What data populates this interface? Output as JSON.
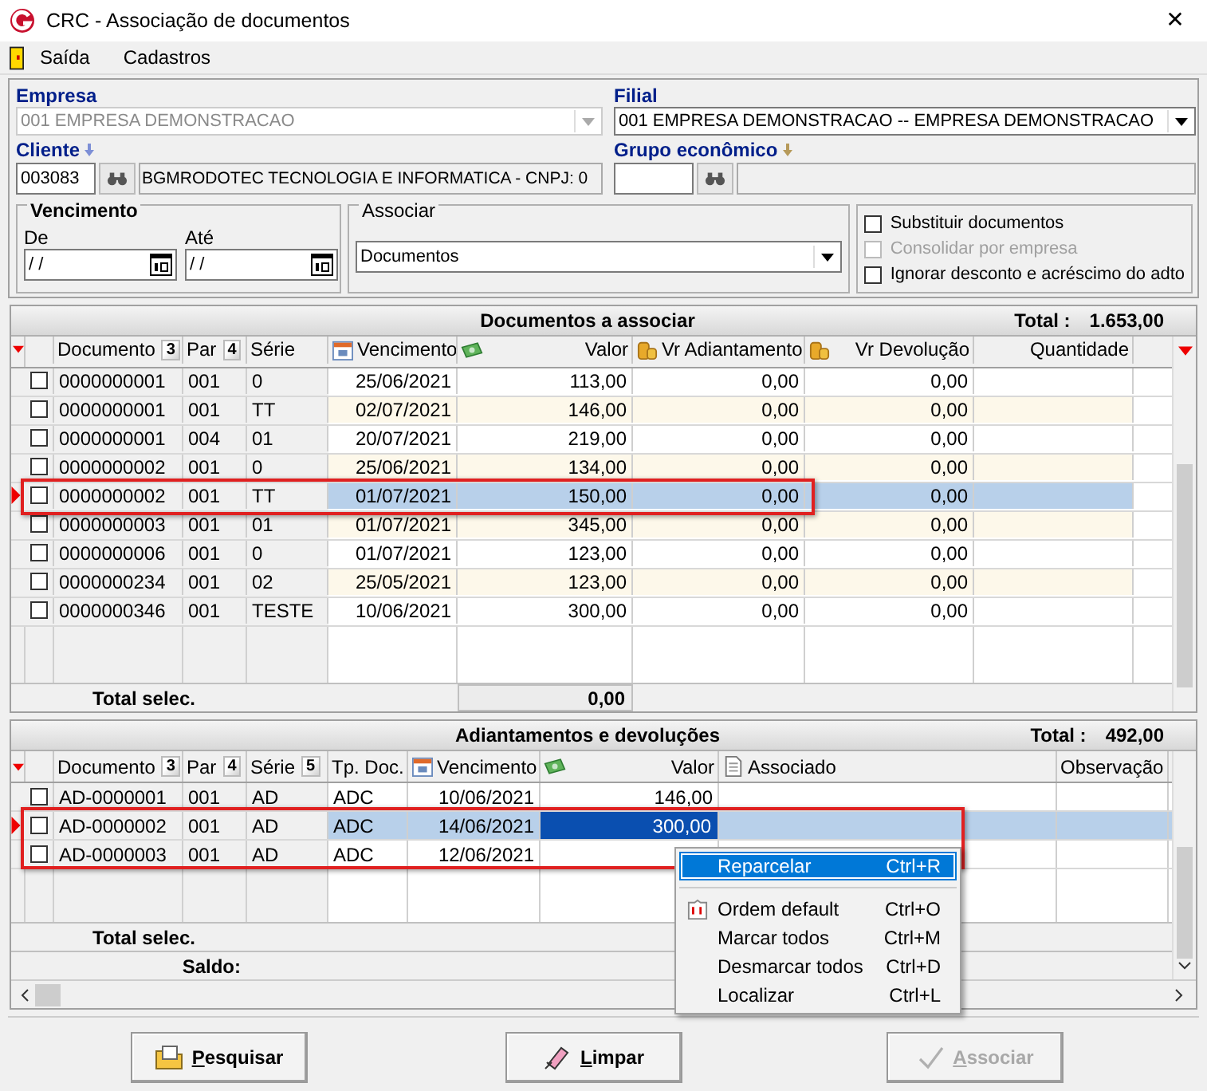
{
  "window": {
    "title": "CRC - Associação de documentos",
    "close": "✕"
  },
  "menu": [
    "Saída",
    "Cadastros"
  ],
  "filters": {
    "empresa": {
      "label": "Empresa",
      "value": "001 EMPRESA DEMONSTRACAO",
      "disabled": true
    },
    "filial": {
      "label": "Filial",
      "value": "001 EMPRESA DEMONSTRACAO -- EMPRESA DEMONSTRACAO",
      "disabled": false
    },
    "cliente": {
      "label": "Cliente",
      "code": "003083",
      "name": "BGMRODOTEC TECNOLOGIA  E INFORMATICA - CNPJ: 0"
    },
    "grupo": {
      "label": "Grupo econômico"
    },
    "vencimento": {
      "label": "Vencimento",
      "de_label": "De",
      "de": " /  /",
      "ate_label": "Até",
      "ate": " /  /"
    },
    "associar": {
      "label": "Associar",
      "value": "Documentos"
    },
    "options": [
      {
        "label": "Substituir documentos",
        "checked": false,
        "disabled": false
      },
      {
        "label": "Consolidar por empresa",
        "checked": false,
        "disabled": true
      },
      {
        "label": "Ignorar desconto e acréscimo do adto",
        "checked": false,
        "disabled": false
      }
    ]
  },
  "documentos": {
    "title": "Documentos a associar",
    "total_label": "Total :",
    "total": "1.653,00",
    "columns": [
      {
        "label": "Documento",
        "sort": "3",
        "kind": "text"
      },
      {
        "label": "Par",
        "sort": "4",
        "kind": "text"
      },
      {
        "label": "Série",
        "kind": "text"
      },
      {
        "label": "Vencimento",
        "kind": "date"
      },
      {
        "label": "Valor",
        "kind": "money"
      },
      {
        "label": "Vr Adiantamento",
        "kind": "coins"
      },
      {
        "label": "Vr Devolução",
        "kind": "coins"
      },
      {
        "label": "Quantidade",
        "kind": "number"
      }
    ],
    "rows": [
      {
        "checked": false,
        "selected": false,
        "cells": [
          "0000000001",
          "001",
          "0",
          "25/06/2021",
          "113,00",
          "0,00",
          "0,00",
          ""
        ]
      },
      {
        "checked": false,
        "selected": false,
        "cells": [
          "0000000001",
          "001",
          "TT",
          "02/07/2021",
          "146,00",
          "0,00",
          "0,00",
          ""
        ]
      },
      {
        "checked": false,
        "selected": false,
        "cells": [
          "0000000001",
          "004",
          "01",
          "20/07/2021",
          "219,00",
          "0,00",
          "0,00",
          ""
        ]
      },
      {
        "checked": false,
        "selected": false,
        "cells": [
          "0000000002",
          "001",
          "0",
          "25/06/2021",
          "134,00",
          "0,00",
          "0,00",
          ""
        ]
      },
      {
        "checked": false,
        "selected": true,
        "cells": [
          "0000000002",
          "001",
          "TT",
          "01/07/2021",
          "150,00",
          "0,00",
          "0,00",
          ""
        ]
      },
      {
        "checked": false,
        "selected": false,
        "cells": [
          "0000000003",
          "001",
          "01",
          "01/07/2021",
          "345,00",
          "0,00",
          "0,00",
          ""
        ]
      },
      {
        "checked": false,
        "selected": false,
        "cells": [
          "0000000006",
          "001",
          "0",
          "01/07/2021",
          "123,00",
          "0,00",
          "0,00",
          ""
        ]
      },
      {
        "checked": false,
        "selected": false,
        "cells": [
          "0000000234",
          "001",
          "02",
          "25/05/2021",
          "123,00",
          "0,00",
          "0,00",
          ""
        ]
      },
      {
        "checked": false,
        "selected": false,
        "cells": [
          "0000000346",
          "001",
          "TESTE",
          "10/06/2021",
          "300,00",
          "0,00",
          "0,00",
          ""
        ]
      }
    ],
    "footer_label": "Total selec.",
    "footer_value": "0,00"
  },
  "adiantamentos": {
    "title": "Adiantamentos e devoluções",
    "total_label": "Total :",
    "total": "492,00",
    "columns": [
      {
        "label": "Documento",
        "sort": "3",
        "kind": "text"
      },
      {
        "label": "Par",
        "sort": "4",
        "kind": "text"
      },
      {
        "label": "Série",
        "sort": "5",
        "kind": "text"
      },
      {
        "label": "Tp. Doc.",
        "kind": "text"
      },
      {
        "label": "Vencimento",
        "kind": "date"
      },
      {
        "label": "Valor",
        "kind": "money"
      },
      {
        "label": "Associado",
        "kind": "note"
      },
      {
        "label": "Observação",
        "kind": "text"
      }
    ],
    "rows": [
      {
        "checked": false,
        "selected": false,
        "cells": [
          "AD-0000001",
          "001",
          "AD",
          "ADC",
          "10/06/2021",
          "146,00",
          "",
          ""
        ]
      },
      {
        "checked": false,
        "selected": true,
        "cells": [
          "AD-0000002",
          "001",
          "AD",
          "ADC",
          "14/06/2021",
          "300,00",
          "",
          ""
        ]
      },
      {
        "checked": false,
        "selected": false,
        "cells": [
          "AD-0000003",
          "001",
          "AD",
          "ADC",
          "12/06/2021",
          "",
          "",
          ""
        ]
      }
    ],
    "footer_label": "Total selec.",
    "saldo_label": "Saldo:"
  },
  "context_menu": {
    "groups": [
      [
        {
          "label": "Reparcelar",
          "shortcut": "Ctrl+R",
          "selected": true,
          "kind": "plain"
        }
      ],
      [
        {
          "label": "Ordem default",
          "shortcut": "Ctrl+O",
          "selected": false,
          "kind": "icon"
        },
        {
          "label": "Marcar todos",
          "shortcut": "Ctrl+M",
          "selected": false,
          "kind": "plain"
        },
        {
          "label": "Desmarcar todos",
          "shortcut": "Ctrl+D",
          "selected": false,
          "kind": "plain"
        },
        {
          "label": "Localizar",
          "shortcut": "Ctrl+L",
          "selected": false,
          "kind": "plain"
        }
      ]
    ]
  },
  "buttons": [
    {
      "label": "Pesquisar",
      "kind": "search",
      "disabled": false
    },
    {
      "label": "Limpar",
      "kind": "clear",
      "disabled": false
    },
    {
      "label": "Associar",
      "kind": "check",
      "disabled": true
    }
  ]
}
